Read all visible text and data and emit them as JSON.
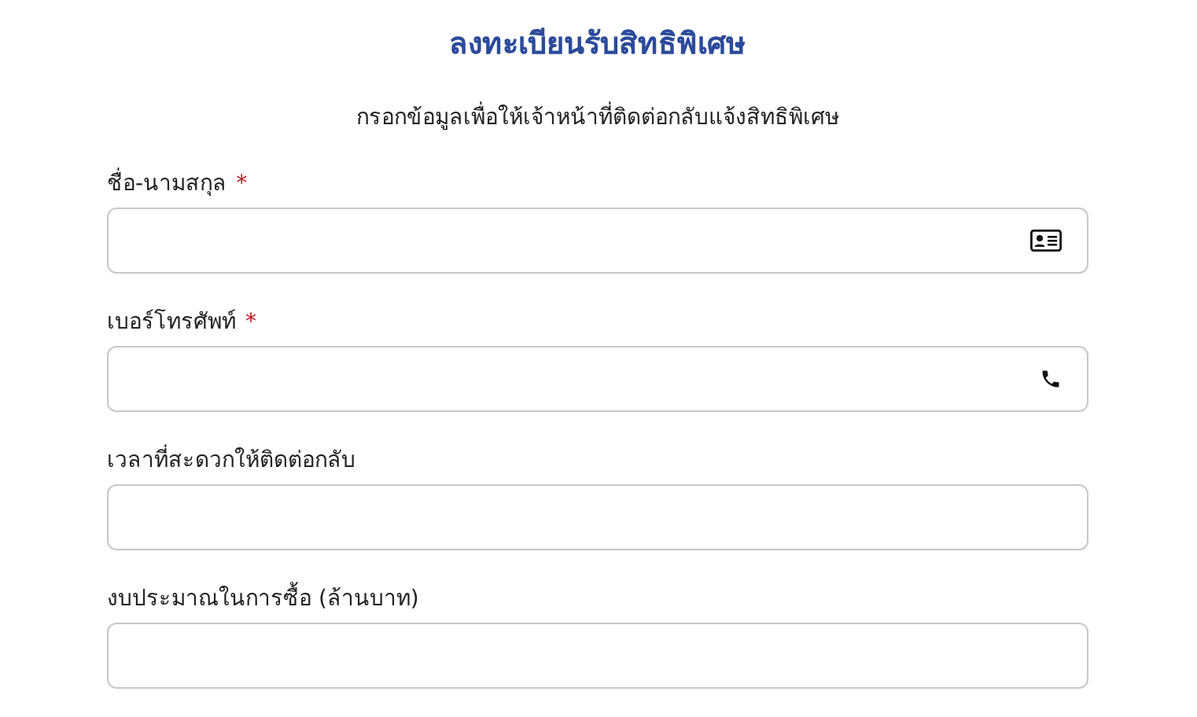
{
  "title": "ลงทะเบียนรับสิทธิพิเศษ",
  "subtitle": "กรอกข้อมูลเพื่อให้เจ้าหน้าที่ติดต่อกลับแจ้งสิทธิพิเศษ",
  "fields": [
    {
      "label": "ชื่อ-นามสกุล",
      "required_mark": "*",
      "kind": "name"
    },
    {
      "label": "เบอร์โทรศัพท์",
      "required_mark": "*",
      "kind": "phone"
    },
    {
      "label": "เวลาที่สะดวกให้ติดต่อกลับ",
      "kind": "plain"
    },
    {
      "label": "งบประมาณในการซื้อ (ล้านบาท)",
      "kind": "plain"
    }
  ]
}
